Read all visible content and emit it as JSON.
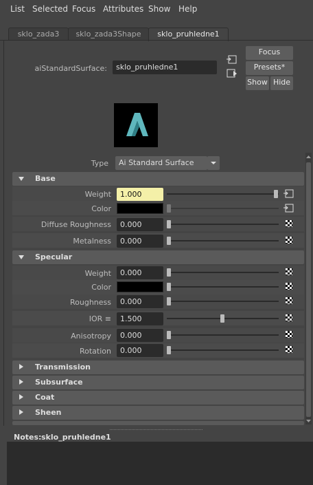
{
  "menu": [
    "List",
    "Selected",
    "Focus",
    "Attributes",
    "Show",
    "Help"
  ],
  "tabs": [
    {
      "label": "sklo_zada3",
      "active": false
    },
    {
      "label": "sklo_zada3Shape",
      "active": false
    },
    {
      "label": "sklo_pruhledne1",
      "active": true
    }
  ],
  "header": {
    "node_type_label": "aiStandardSurface:",
    "node_name": "sklo_pruhledne1",
    "focus_label": "Focus",
    "presets_label": "Presets*",
    "show_label": "Show",
    "hide_label": "Hide"
  },
  "type_row": {
    "label": "Type",
    "value": "Ai Standard Surface"
  },
  "base": {
    "title": "Base",
    "weight": {
      "label": "Weight",
      "value": "1.000",
      "slider": 1.0
    },
    "color": {
      "label": "Color",
      "value_color": "#000000"
    },
    "diffuse_roughness": {
      "label": "Diffuse Roughness",
      "value": "0.000",
      "slider": 0.0
    },
    "metalness": {
      "label": "Metalness",
      "value": "0.000",
      "slider": 0.0
    }
  },
  "specular": {
    "title": "Specular",
    "weight": {
      "label": "Weight",
      "value": "0.000",
      "slider": 0.0
    },
    "color": {
      "label": "Color",
      "value_color": "#000000"
    },
    "roughness": {
      "label": "Roughness",
      "value": "0.000",
      "slider": 0.0
    },
    "ior": {
      "label": "IOR ≡",
      "value": "1.500",
      "slider": 0.5
    },
    "anisotropy": {
      "label": "Anisotropy",
      "value": "0.000",
      "slider": 0.0
    },
    "rotation": {
      "label": "Rotation",
      "value": "0.000",
      "slider": 0.0
    }
  },
  "collapsed_sections": [
    "Transmission",
    "Subsurface",
    "Coat",
    "Sheen"
  ],
  "notes": {
    "label": "Notes:",
    "node": "sklo_pruhledne1"
  },
  "colors": {
    "weight_field_highlight": "#f4f0a8",
    "accent_swatch": "#5fb7bd"
  }
}
